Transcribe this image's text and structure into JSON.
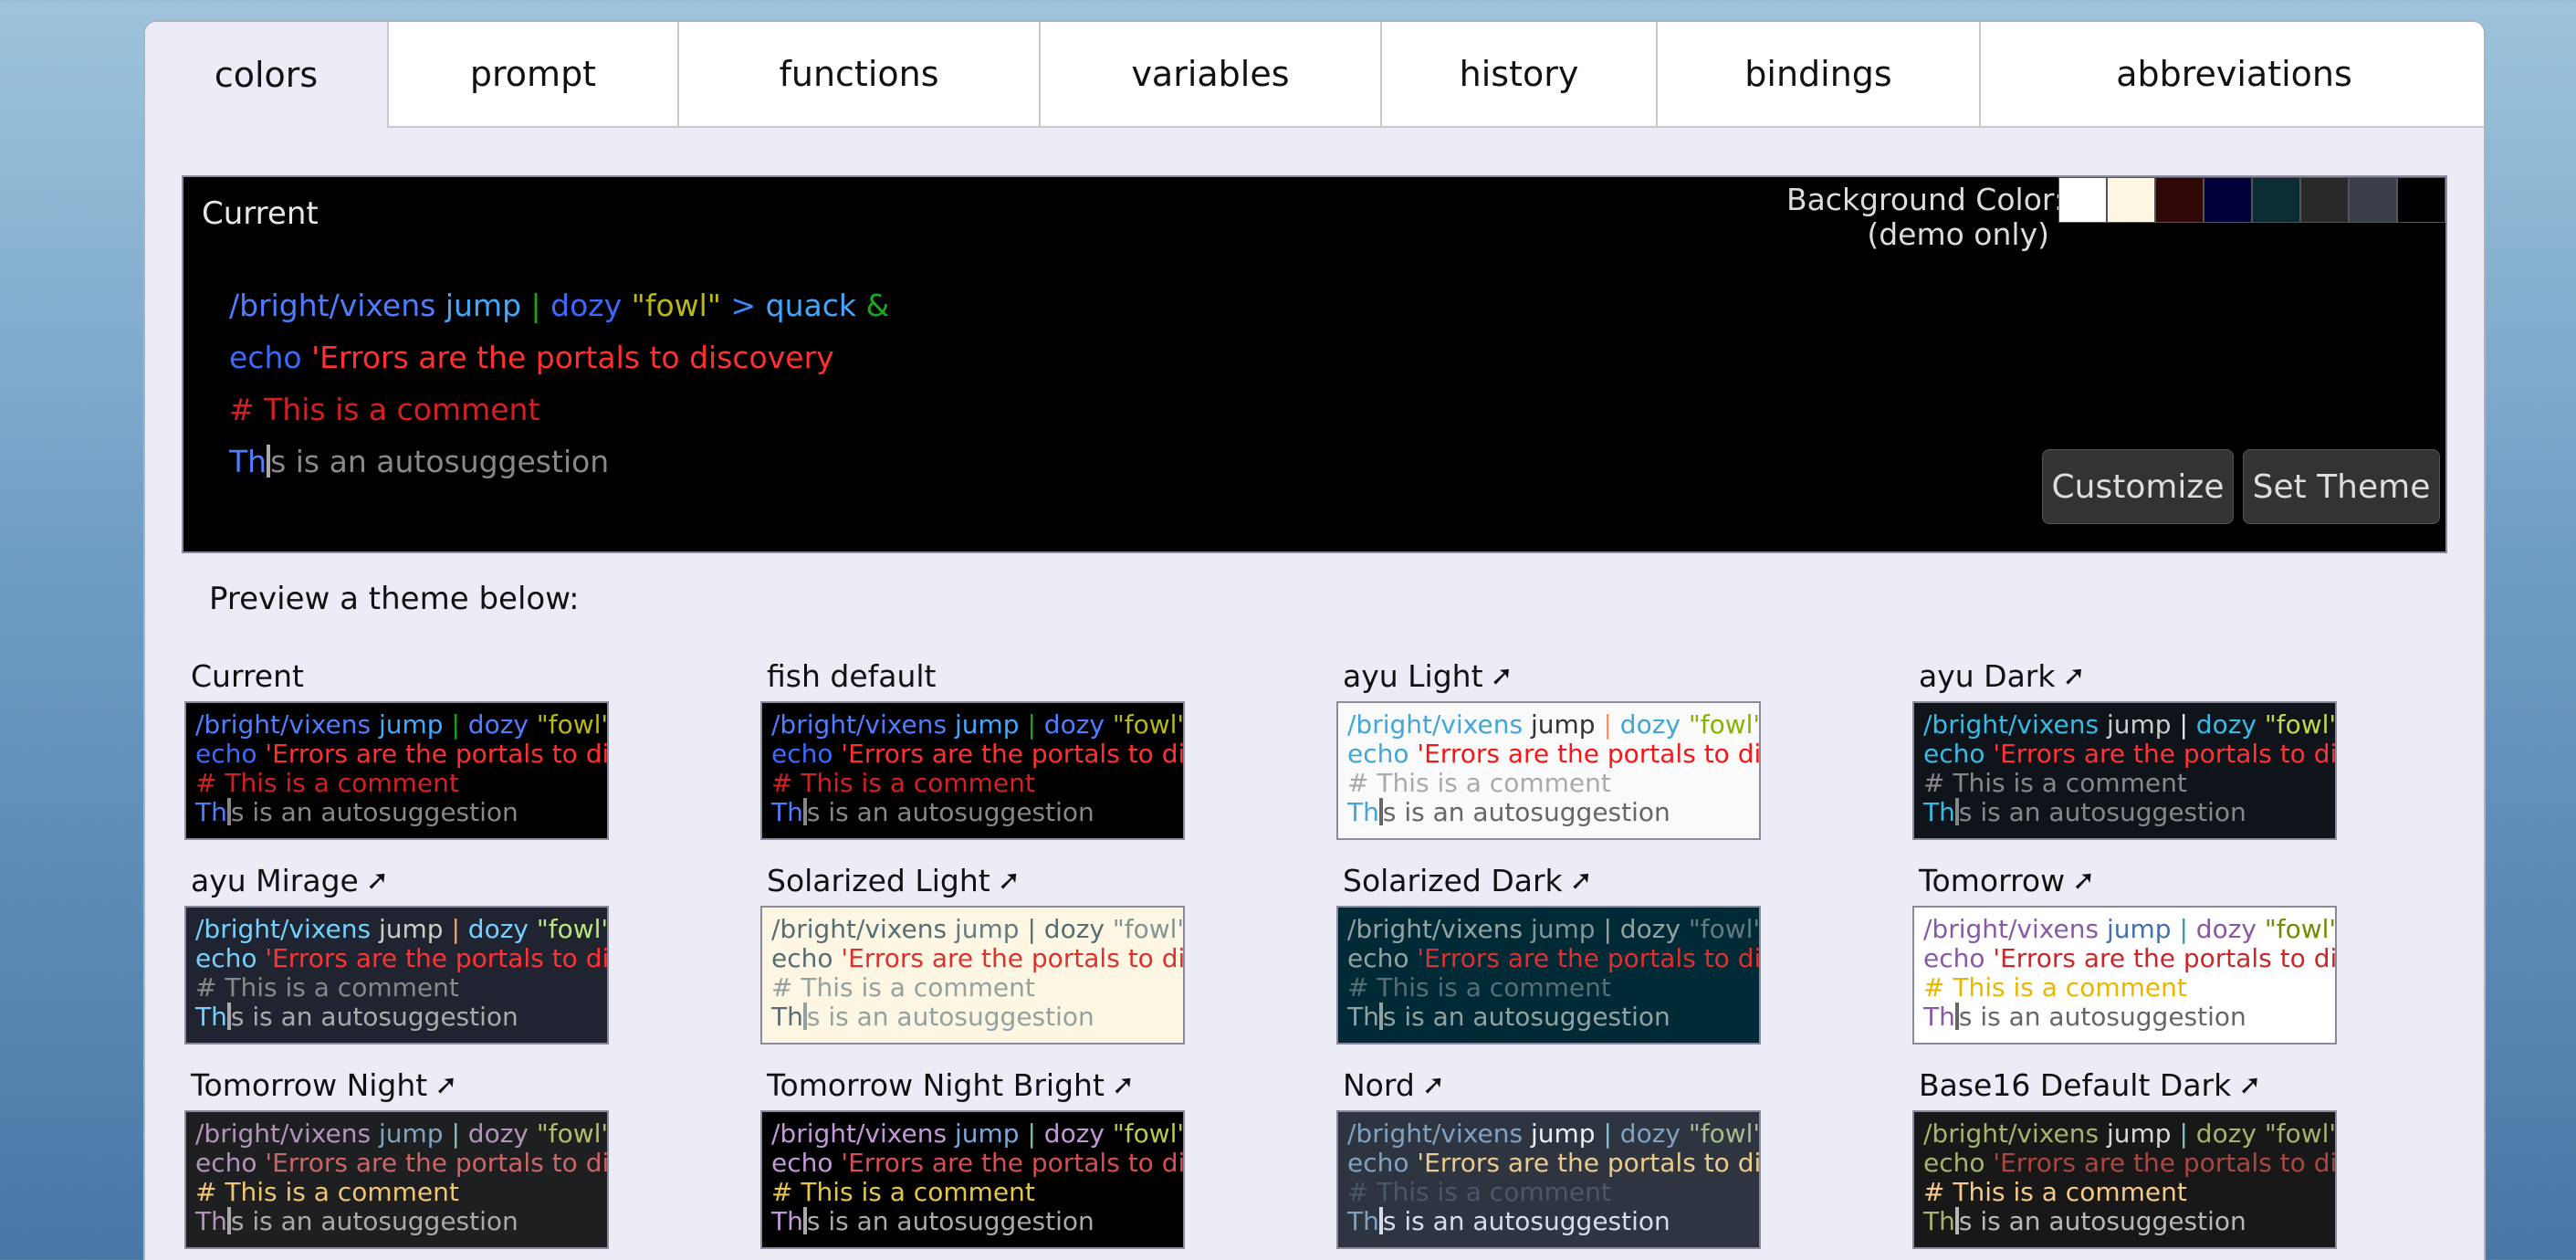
{
  "tabs": [
    {
      "label": "colors",
      "active": true
    },
    {
      "label": "prompt"
    },
    {
      "label": "functions"
    },
    {
      "label": "variables"
    },
    {
      "label": "history"
    },
    {
      "label": "bindings"
    },
    {
      "label": "abbreviations"
    }
  ],
  "current": {
    "label": "Current",
    "bg_label_line1": "Background Color:",
    "bg_label_line2": "(demo only)",
    "swatch_colors": [
      "#ffffff",
      "#fcf6e3",
      "#2f0707",
      "#00003a",
      "#0b2b35",
      "#292929",
      "#3a3f4a",
      "#000000"
    ],
    "customize_label": "Customize",
    "set_theme_label": "Set Theme"
  },
  "sample": {
    "cmd": "/bright/vixens",
    "param": "jump",
    "pipe": "|",
    "cmd2": "dozy",
    "quote": "\"fowl\"",
    "redir": ">",
    "param2": "quack",
    "amp": "&",
    "echo": "echo",
    "error": "'Errors are the portals to discovery",
    "comment": "# This is a comment",
    "auto_typed": "Th",
    "auto_cursor_char": "i",
    "auto_rest": "s is an autosuggestion"
  },
  "preview_heading": "Preview a theme below:",
  "themes": [
    {
      "name": "Current",
      "link": false,
      "bg": "#000000",
      "border": "#8a8a9a",
      "c": {
        "cmd": "#4f7dff",
        "param": "#40a8ff",
        "pipe": "#18a818",
        "quote": "#b8b818",
        "redir": "#3a8aff",
        "echo": "#3a6aff",
        "error": "#ff3030",
        "comment": "#d42020",
        "auto": "#888888",
        "typed": "#4f7dff"
      }
    },
    {
      "name": "fish default",
      "link": false,
      "bg": "#000000",
      "border": "#8a8a9a",
      "c": {
        "cmd": "#4f7dff",
        "param": "#40a8ff",
        "pipe": "#18a818",
        "quote": "#b8b818",
        "redir": "#3a8aff",
        "echo": "#3a6aff",
        "error": "#ff3030",
        "comment": "#d42020",
        "auto": "#888888",
        "typed": "#4f7dff"
      }
    },
    {
      "name": "ayu Light",
      "link": true,
      "bg": "#fafafa",
      "border": "#8a8a9a",
      "c": {
        "cmd": "#41a6d9",
        "param": "#333333",
        "pipe": "#ed9366",
        "quote": "#86b300",
        "redir": "#41a6d9",
        "echo": "#41a6d9",
        "error": "#f01818",
        "comment": "#aaaaaa",
        "auto": "#666666",
        "typed": "#41a6d9"
      }
    },
    {
      "name": "ayu Dark",
      "link": true,
      "bg": "#0e1419",
      "border": "#8a8a9a",
      "c": {
        "cmd": "#39bae6",
        "param": "#cccccc",
        "pipe": "#e6e6e6",
        "quote": "#c2d94c",
        "redir": "#ffffff",
        "echo": "#39bae6",
        "error": "#ff3333",
        "comment": "#888888",
        "auto": "#888888",
        "typed": "#39bae6"
      }
    },
    {
      "name": "ayu Mirage",
      "link": true,
      "bg": "#1f2430",
      "border": "#8a8a9a",
      "c": {
        "cmd": "#73d0ff",
        "param": "#cbccc6",
        "pipe": "#f29e74",
        "quote": "#bae67e",
        "redir": "#ffffff",
        "echo": "#73d0ff",
        "error": "#ff3333",
        "comment": "#888888",
        "auto": "#aaaaaa",
        "typed": "#73d0ff"
      }
    },
    {
      "name": "Solarized Light",
      "link": true,
      "bg": "#fdf6e3",
      "border": "#8a8a9a",
      "c": {
        "cmd": "#586e75",
        "param": "#657b83",
        "pipe": "#586e75",
        "quote": "#839496",
        "redir": "#586e75",
        "echo": "#586e75",
        "error": "#dc322f",
        "comment": "#93a1a1",
        "auto": "#93a1a1",
        "typed": "#586e75"
      }
    },
    {
      "name": "Solarized Dark",
      "link": true,
      "bg": "#002b36",
      "border": "#8a8a9a",
      "c": {
        "cmd": "#93a1a1",
        "param": "#839496",
        "pipe": "#93a1a1",
        "quote": "#657b83",
        "redir": "#93a1a1",
        "echo": "#93a1a1",
        "error": "#dc322f",
        "comment": "#586e75",
        "auto": "#93a1a1",
        "typed": "#93a1a1"
      }
    },
    {
      "name": "Tomorrow",
      "link": true,
      "bg": "#ffffff",
      "border": "#8a8a9a",
      "c": {
        "cmd": "#8959a8",
        "param": "#4271ae",
        "pipe": "#3e999f",
        "quote": "#718c00",
        "redir": "#3e999f",
        "echo": "#8959a8",
        "error": "#c82829",
        "comment": "#eab700",
        "auto": "#666666",
        "typed": "#8959a8"
      }
    },
    {
      "name": "Tomorrow Night",
      "link": true,
      "bg": "#1d1f21",
      "border": "#8a8a9a",
      "c": {
        "cmd": "#b294bb",
        "param": "#81a2be",
        "pipe": "#8abeb7",
        "quote": "#b5bd68",
        "redir": "#8abeb7",
        "echo": "#b294bb",
        "error": "#cc6666",
        "comment": "#f0c674",
        "auto": "#aaaaaa",
        "typed": "#b294bb"
      }
    },
    {
      "name": "Tomorrow Night Bright",
      "link": true,
      "bg": "#000000",
      "border": "#8a8a9a",
      "c": {
        "cmd": "#c397d8",
        "param": "#7aa6da",
        "pipe": "#70c0b1",
        "quote": "#b9ca4a",
        "redir": "#70c0b1",
        "echo": "#c397d8",
        "error": "#d54e53",
        "comment": "#e7c547",
        "auto": "#aaaaaa",
        "typed": "#c397d8"
      }
    },
    {
      "name": "Nord",
      "link": true,
      "bg": "#2e3440",
      "border": "#8a8a9a",
      "c": {
        "cmd": "#81a1c1",
        "param": "#eceff4",
        "pipe": "#88c0d0",
        "quote": "#a3be8c",
        "redir": "#e5e9f0",
        "echo": "#81a1c1",
        "error": "#ebcb8b",
        "comment": "#4c566a",
        "auto": "#d8dee9",
        "typed": "#81a1c1"
      }
    },
    {
      "name": "Base16 Default Dark",
      "link": true,
      "bg": "#181818",
      "border": "#8a8a9a",
      "c": {
        "cmd": "#a1b56c",
        "param": "#d8d8d8",
        "pipe": "#86c1b9",
        "quote": "#a1b56c",
        "redir": "#ffffff",
        "echo": "#a1b56c",
        "error": "#ab4642",
        "comment": "#f7ca88",
        "auto": "#b8b8b8",
        "typed": "#a1b56c"
      }
    }
  ]
}
